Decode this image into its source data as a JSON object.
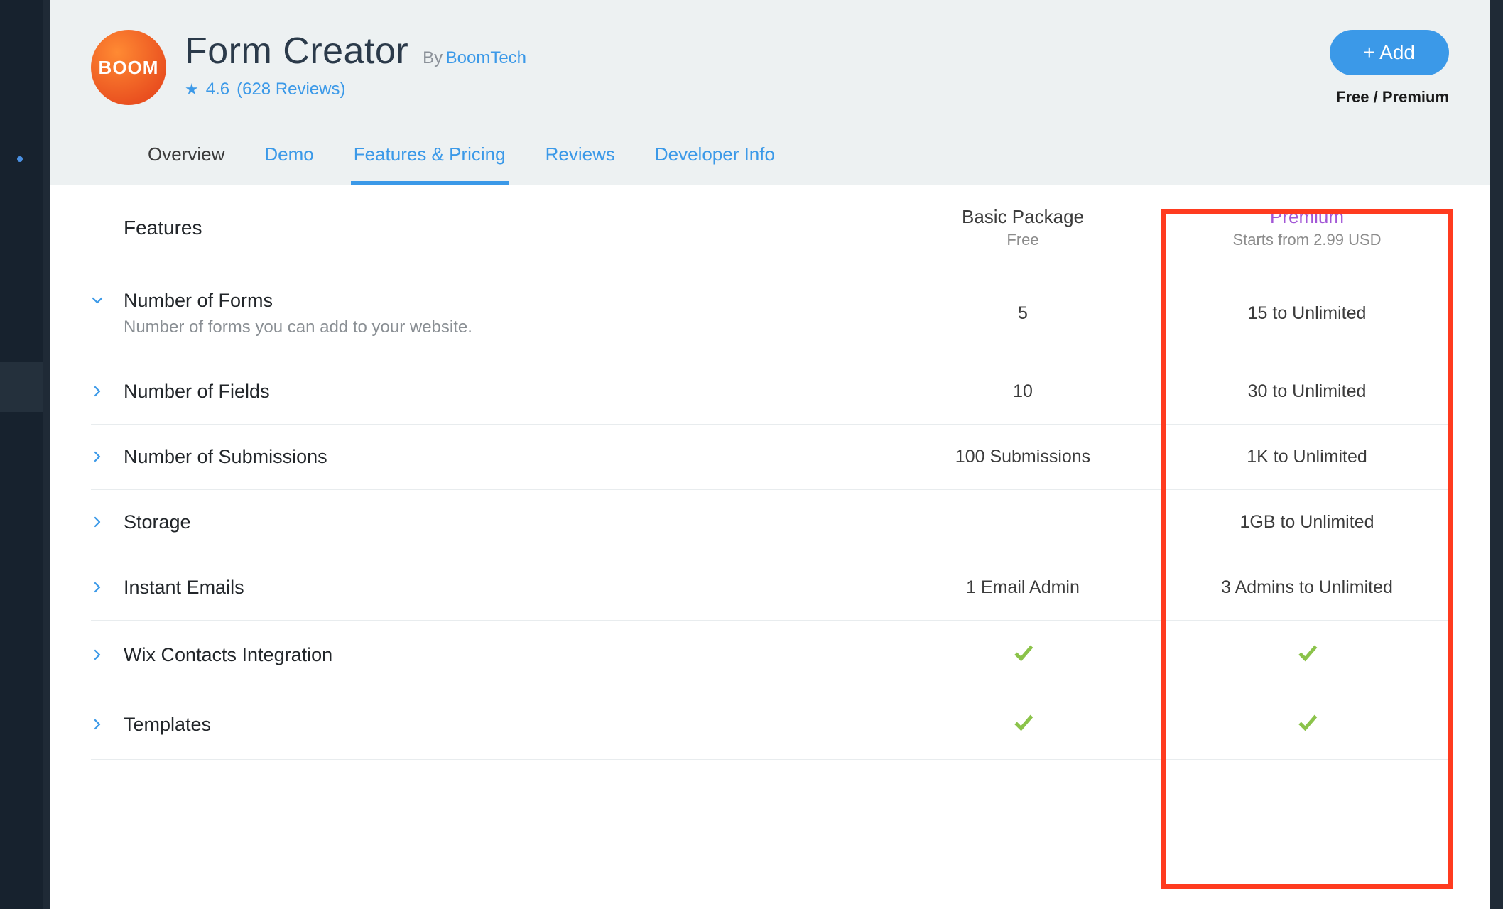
{
  "header": {
    "logo_text": "BOOM",
    "title": "Form Creator",
    "by_label": "By",
    "vendor": "BoomTech",
    "rating_value": "4.6",
    "reviews_count": "(628 Reviews)",
    "add_button": "+ Add",
    "tier_text": "Free / Premium"
  },
  "tabs": [
    {
      "label": "Overview",
      "active": false,
      "inactive_style": true
    },
    {
      "label": "Demo",
      "active": false,
      "inactive_style": false
    },
    {
      "label": "Features & Pricing",
      "active": true,
      "inactive_style": false
    },
    {
      "label": "Reviews",
      "active": false,
      "inactive_style": false
    },
    {
      "label": "Developer Info",
      "active": false,
      "inactive_style": false
    }
  ],
  "table_header": {
    "features_label": "Features",
    "basic": {
      "title": "Basic Package",
      "sub": "Free"
    },
    "premium": {
      "title": "Premium",
      "sub": "Starts from 2.99 USD"
    }
  },
  "rows": [
    {
      "title": "Number of Forms",
      "desc": "Number of forms you can add to your website.",
      "expanded": true,
      "basic": "5",
      "premium": "15 to Unlimited",
      "basic_check": false,
      "premium_check": false
    },
    {
      "title": "Number of Fields",
      "desc": "",
      "expanded": false,
      "basic": "10",
      "premium": "30 to Unlimited",
      "basic_check": false,
      "premium_check": false
    },
    {
      "title": "Number of Submissions",
      "desc": "",
      "expanded": false,
      "basic": "100 Submissions",
      "premium": "1K to Unlimited",
      "basic_check": false,
      "premium_check": false
    },
    {
      "title": "Storage",
      "desc": "",
      "expanded": false,
      "basic": "",
      "premium": "1GB to Unlimited",
      "basic_check": false,
      "premium_check": false
    },
    {
      "title": "Instant Emails",
      "desc": "",
      "expanded": false,
      "basic": "1 Email Admin",
      "premium": "3 Admins to Unlimited",
      "basic_check": false,
      "premium_check": false
    },
    {
      "title": "Wix Contacts Integration",
      "desc": "",
      "expanded": false,
      "basic": "",
      "premium": "",
      "basic_check": true,
      "premium_check": true
    },
    {
      "title": "Templates",
      "desc": "",
      "expanded": false,
      "basic": "",
      "premium": "",
      "basic_check": true,
      "premium_check": true
    }
  ]
}
